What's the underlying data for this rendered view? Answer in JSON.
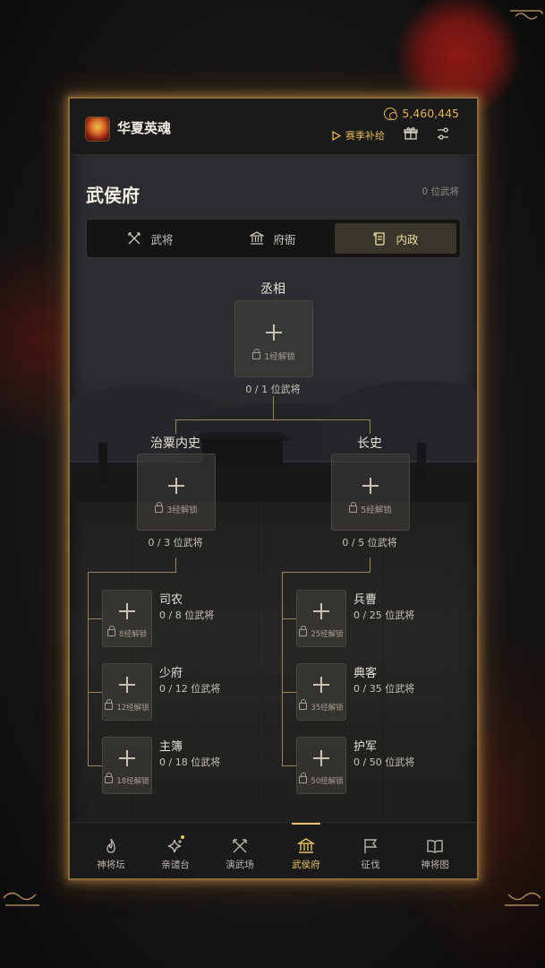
{
  "app": {
    "name": "华夏英魂",
    "coins": "5,460,445",
    "season_label": "赛季补给"
  },
  "page": {
    "title": "武侯府",
    "total_count": "0 位武将"
  },
  "tabs": [
    {
      "label": "武将",
      "icon": "crossed-swords-icon",
      "active": false
    },
    {
      "label": "府衙",
      "icon": "temple-icon",
      "active": false
    },
    {
      "label": "内政",
      "icon": "scroll-icon",
      "active": true
    }
  ],
  "tree": {
    "root": {
      "title": "丞相",
      "unlock": "1经解锁",
      "occupancy": "0 / 1 位武将"
    },
    "left": {
      "title": "治粟内史",
      "unlock": "3经解锁",
      "occupancy": "0 / 3 位武将"
    },
    "right": {
      "title": "长史",
      "unlock": "5经解锁",
      "occupancy": "0 / 5 位武将"
    },
    "left_children": [
      {
        "name": "司农",
        "unlock": "8经解锁",
        "occupancy": "0 / 8 位武将"
      },
      {
        "name": "少府",
        "unlock": "12经解锁",
        "occupancy": "0 / 12 位武将"
      },
      {
        "name": "主簿",
        "unlock": "18经解锁",
        "occupancy": "0 / 18 位武将"
      }
    ],
    "right_children": [
      {
        "name": "兵曹",
        "unlock": "25经解锁",
        "occupancy": "0 / 25 位武将"
      },
      {
        "name": "典客",
        "unlock": "35经解锁",
        "occupancy": "0 / 35 位武将"
      },
      {
        "name": "护军",
        "unlock": "50经解锁",
        "occupancy": "0 / 50 位武将"
      }
    ]
  },
  "nav": [
    {
      "label": "神将坛",
      "icon": "flame-icon",
      "active": false
    },
    {
      "label": "亲谴台",
      "icon": "sparkle-icon",
      "active": false,
      "badge": true
    },
    {
      "label": "演武场",
      "icon": "crossed-swords-icon",
      "active": false
    },
    {
      "label": "武侯府",
      "icon": "temple-icon",
      "active": true
    },
    {
      "label": "征伐",
      "icon": "flag-icon",
      "active": false
    },
    {
      "label": "神将图",
      "icon": "book-icon",
      "active": false
    }
  ],
  "colors": {
    "accent": "#e8c26a",
    "frame": "#8a6a3c",
    "connector": "#9b8457"
  }
}
